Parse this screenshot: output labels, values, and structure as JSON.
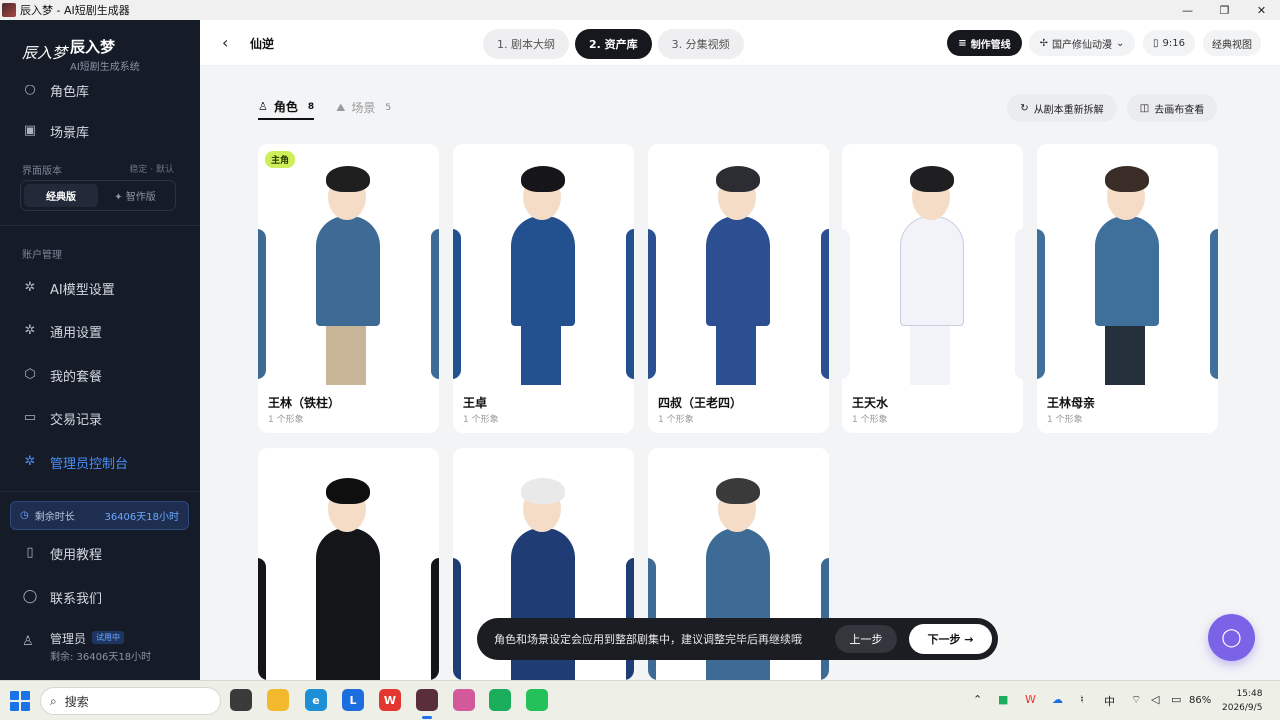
{
  "window": {
    "title": "辰入梦 - AI短剧生成器",
    "controls": [
      "—",
      "❐",
      "✕"
    ]
  },
  "sidebar": {
    "logo_text": "辰入梦",
    "brand_name": "辰入梦",
    "brand_sub": "AI短剧生成系统",
    "partial_item": "角色库",
    "scene_lib": "场景库",
    "ui_version_label": "界面版本",
    "ui_version_hint": "稳定 · 默认",
    "version_classic": "经典版",
    "version_smart": "✦ 智作版",
    "account_label": "账户管理",
    "items": [
      {
        "label": "AI模型设置",
        "icon": "gear-icon"
      },
      {
        "label": "通用设置",
        "icon": "gear-icon"
      },
      {
        "label": "我的套餐",
        "icon": "package-icon"
      },
      {
        "label": "交易记录",
        "icon": "card-icon"
      },
      {
        "label": "管理员控制台",
        "icon": "gear-icon",
        "active": true
      }
    ],
    "remaining_label": "剩余时长",
    "remaining_value": "36406天18小时",
    "tutorial": "使用教程",
    "contact": "联系我们",
    "user_name": "管理员",
    "user_badge": "试用中",
    "user_sub": "剩余: 36406天18小时"
  },
  "topbar": {
    "back_glyph": "‹",
    "project_title": "仙逆",
    "steps": [
      "1. 剧本大纲",
      "2. 资产库",
      "3. 分集视频"
    ],
    "active_step": 1,
    "pipeline": "制作管线",
    "style": "国产修仙动漫",
    "ratio": "9:16",
    "view": "经典视图"
  },
  "tabs": [
    {
      "label": "角色",
      "count": "8",
      "active": true
    },
    {
      "label": "场景",
      "count": "5",
      "active": false
    }
  ],
  "actions": {
    "re_split": "从剧本重新拆解",
    "canvas": "去画布查看"
  },
  "characters": [
    {
      "name": "王林（铁柱）",
      "sub": "1 个形象",
      "main_badge": "主角",
      "hair": "#1e1e1e",
      "robe": "#3d6b96",
      "pants": "#c8b496"
    },
    {
      "name": "王卓",
      "sub": "1 个形象",
      "hair": "#15151a",
      "robe": "#23508f",
      "pants": "#23508f"
    },
    {
      "name": "四叔（王老四）",
      "sub": "1 个形象",
      "hair": "#2c2c33",
      "robe": "#2c4f91",
      "pants": "#2c4f91"
    },
    {
      "name": "王天水",
      "sub": "1 个形象",
      "hair": "#1f1f22",
      "robe": "#f1f3f8",
      "pants": "#f1f3f8"
    },
    {
      "name": "王林母亲",
      "sub": "1 个形象",
      "hair": "#3a2c26",
      "robe": "#3f6f9b",
      "pants": "#26303c"
    },
    {
      "name": "",
      "sub": "",
      "hair": "#0f0f10",
      "robe": "#141518",
      "pants": "#141518"
    },
    {
      "name": "",
      "sub": "",
      "hair": "#e9e9e9",
      "robe": "#1f3c74",
      "pants": "#1f3c74"
    },
    {
      "name": "",
      "sub": "",
      "hair": "#3a3a3a",
      "robe": "#3d6b96",
      "pants": "#bcbcbc"
    }
  ],
  "footer": {
    "message": "角色和场景设定会应用到整部剧集中，建议调整完毕后再继续哦",
    "prev": "上一步",
    "next": "下一步 →"
  },
  "taskbar": {
    "search_placeholder": "搜索",
    "ime": "中",
    "battery": "86%",
    "time": "15:48",
    "date": "2026/9/5"
  }
}
